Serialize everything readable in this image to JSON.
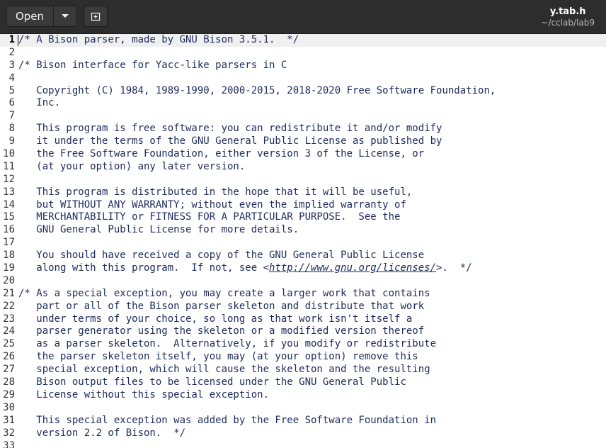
{
  "header": {
    "open_label": "Open",
    "title": "y.tab.h",
    "subtitle": "~/cclab/lab9",
    "icons": {
      "dropdown": "chevron-down-icon",
      "new_document": "new-document-icon"
    }
  },
  "editor": {
    "current_line": 1,
    "lines": [
      {
        "n": "1",
        "t": "/* A Bison parser, made by GNU Bison 3.5.1.  */"
      },
      {
        "n": "2",
        "t": ""
      },
      {
        "n": "3",
        "t": "/* Bison interface for Yacc-like parsers in C"
      },
      {
        "n": "4",
        "t": ""
      },
      {
        "n": "5",
        "t": "   Copyright (C) 1984, 1989-1990, 2000-2015, 2018-2020 Free Software Foundation,"
      },
      {
        "n": "6",
        "t": "   Inc."
      },
      {
        "n": "7",
        "t": ""
      },
      {
        "n": "8",
        "t": "   This program is free software: you can redistribute it and/or modify"
      },
      {
        "n": "9",
        "t": "   it under the terms of the GNU General Public License as published by"
      },
      {
        "n": "10",
        "t": "   the Free Software Foundation, either version 3 of the License, or"
      },
      {
        "n": "11",
        "t": "   (at your option) any later version."
      },
      {
        "n": "12",
        "t": ""
      },
      {
        "n": "13",
        "t": "   This program is distributed in the hope that it will be useful,"
      },
      {
        "n": "14",
        "t": "   but WITHOUT ANY WARRANTY; without even the implied warranty of"
      },
      {
        "n": "15",
        "t": "   MERCHANTABILITY or FITNESS FOR A PARTICULAR PURPOSE.  See the"
      },
      {
        "n": "16",
        "t": "   GNU General Public License for more details."
      },
      {
        "n": "17",
        "t": ""
      },
      {
        "n": "18",
        "t": "   You should have received a copy of the GNU General Public License"
      },
      {
        "n": "19",
        "t": "   along with this program.  If not, see <",
        "link": "http://www.gnu.org/licenses/",
        "after": ">.  */"
      },
      {
        "n": "20",
        "t": ""
      },
      {
        "n": "21",
        "t": "/* As a special exception, you may create a larger work that contains"
      },
      {
        "n": "22",
        "t": "   part or all of the Bison parser skeleton and distribute that work"
      },
      {
        "n": "23",
        "t": "   under terms of your choice, so long as that work isn't itself a"
      },
      {
        "n": "24",
        "t": "   parser generator using the skeleton or a modified version thereof"
      },
      {
        "n": "25",
        "t": "   as a parser skeleton.  Alternatively, if you modify or redistribute"
      },
      {
        "n": "26",
        "t": "   the parser skeleton itself, you may (at your option) remove this"
      },
      {
        "n": "27",
        "t": "   special exception, which will cause the skeleton and the resulting"
      },
      {
        "n": "28",
        "t": "   Bison output files to be licensed under the GNU General Public"
      },
      {
        "n": "29",
        "t": "   License without this special exception."
      },
      {
        "n": "30",
        "t": ""
      },
      {
        "n": "31",
        "t": "   This special exception was added by the Free Software Foundation in"
      },
      {
        "n": "32",
        "t": "   version 2.2 of Bison.  */"
      },
      {
        "n": "33",
        "t": ""
      }
    ]
  }
}
